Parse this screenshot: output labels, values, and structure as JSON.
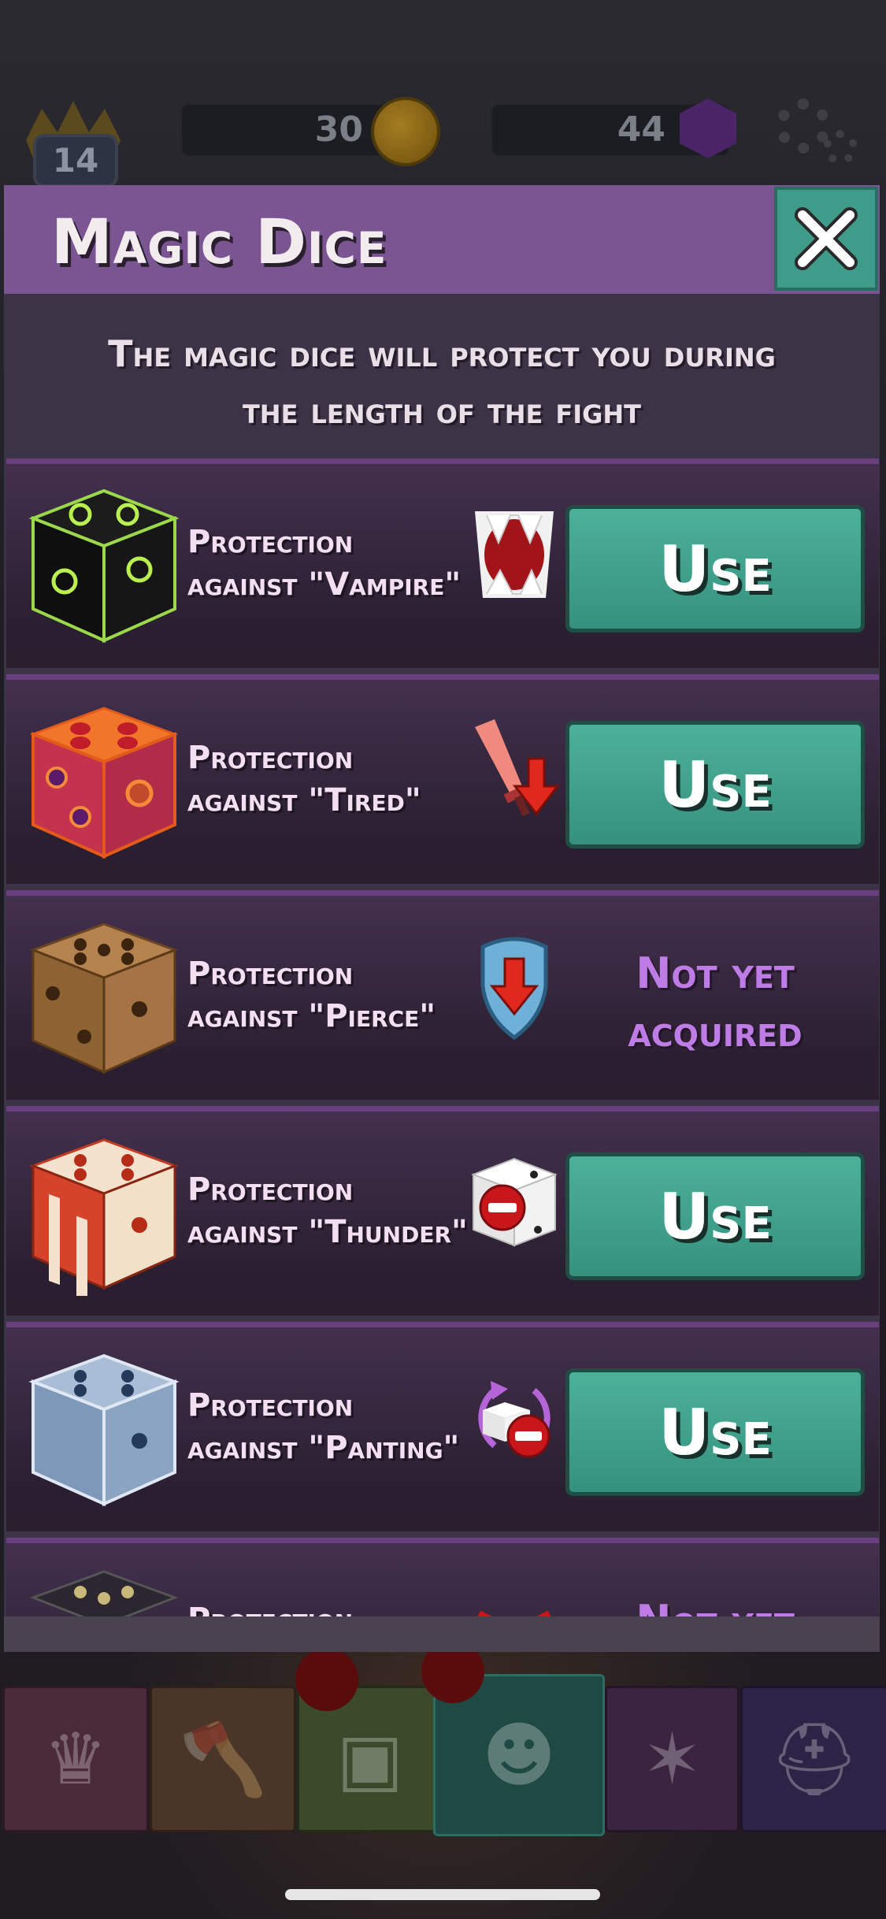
{
  "hud": {
    "level": "14",
    "coins": "30",
    "gems": "44"
  },
  "modal": {
    "title": "Magic Dice",
    "subtitle_line1": "The magic dice will protect you during",
    "subtitle_line2": "the length of the fight"
  },
  "items": [
    {
      "line1": "Protection",
      "line2": "against \"Vampire\"",
      "action": "Use",
      "status": "available"
    },
    {
      "line1": "Protection",
      "line2": "against \"Tired\"",
      "action": "Use",
      "status": "available"
    },
    {
      "line1": "Protection",
      "line2": "against \"Pierce\"",
      "status_line1": "Not yet",
      "status_line2": "acquired",
      "status": "locked"
    },
    {
      "line1": "Protection",
      "line2": "against \"Thunder\"",
      "action": "Use",
      "status": "available"
    },
    {
      "line1": "Protection",
      "line2": "against \"Panting\"",
      "action": "Use",
      "status": "available"
    },
    {
      "line1": "Protection",
      "status_line1": "Not yet",
      "status": "locked"
    }
  ],
  "icons": {
    "close": "close-icon",
    "coin": "coin-icon",
    "gem": "gem-icon",
    "settings": "gear-icon"
  },
  "colors": {
    "header": "#7a5592",
    "use_button": "#3f9b8a",
    "locked_text": "#c07ce6"
  }
}
